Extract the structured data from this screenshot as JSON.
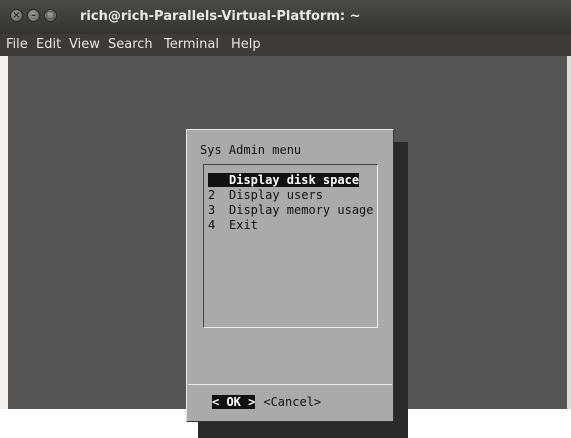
{
  "window": {
    "title": "rich@rich-Parallels-Virtual-Platform: ~",
    "close_icon": "×",
    "minimize_icon": "–",
    "maximize_icon": "□"
  },
  "menubar": {
    "items": [
      "File",
      "Edit",
      "View",
      "Search",
      "Terminal",
      "Help"
    ]
  },
  "dialog": {
    "title": "Sys Admin menu",
    "items": [
      {
        "num": "1",
        "label": "Display disk space",
        "selected": true
      },
      {
        "num": "2",
        "label": "Display users",
        "selected": false
      },
      {
        "num": "3",
        "label": "Display memory usage",
        "selected": false
      },
      {
        "num": "4",
        "label": "Exit",
        "selected": false
      }
    ],
    "ok_label": "< OK >",
    "cancel_label": "<Cancel>"
  },
  "colors": {
    "terminal_bg": "#555555",
    "dialog_bg": "#aaaaaa",
    "shadow": "#2a2a2a",
    "titlebar": "#3c3b37"
  }
}
